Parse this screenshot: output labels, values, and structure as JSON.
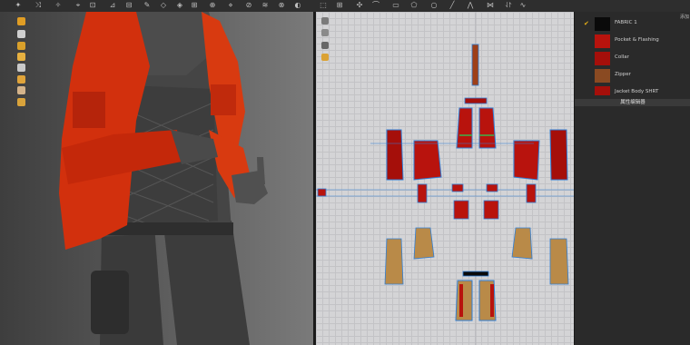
{
  "fabric_list": {
    "items": [
      {
        "label": "FABRIC 1",
        "swatch": "#0a0a0a",
        "checked": true
      },
      {
        "label": "Pocket & Flashing",
        "swatch": "#b8130d",
        "checked": false
      },
      {
        "label": "Collar",
        "swatch": "#a50f0a",
        "checked": false
      },
      {
        "label": "Zipper",
        "swatch": "#8a4a22",
        "checked": false
      },
      {
        "label": "Jacket Body SHRT",
        "swatch": "#a50f0a",
        "checked": false
      }
    ],
    "property_button": "属性编辑器",
    "top_label": "添加"
  },
  "colors": {
    "accent_check": "#e8b016",
    "pattern_red": "#b8130d",
    "pattern_tan": "#b98a48",
    "pattern_outline": "#2f7fd8"
  }
}
